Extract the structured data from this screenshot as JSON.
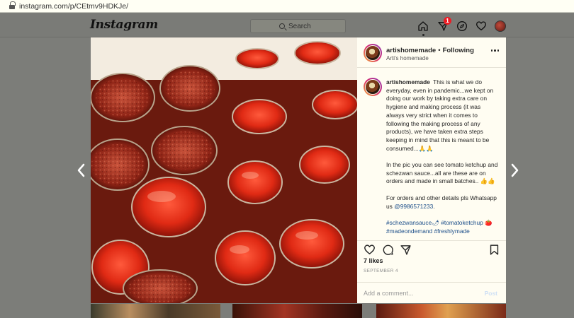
{
  "browser": {
    "url": "instagram.com/p/CEtmv9HDKJe/"
  },
  "header": {
    "logo": "Instagram",
    "search_placeholder": "Search",
    "notification_count": "1"
  },
  "post": {
    "username": "artishomemade",
    "follow_label": "Following",
    "subtitle": "Arti's homemade",
    "caption": {
      "username": "artishomemade",
      "paragraph1": "This is what we do everyday, even in pandemic...we kept on doing our work by taking extra care on hygiene and making process (it was always very strict when it comes to following the making process of any products), we have taken extra steps keeping in mind that this is meant to be consumed...🙏🙏",
      "paragraph2": "In the pic you can see tomato ketchup and schezwan sauce...all are these are on orders and made in small batches.. 👍👍",
      "paragraph3_prefix": "For orders and other details pls Whatsapp us ",
      "phone": "@9986571233",
      "paragraph3_suffix": ".",
      "hashtags": "#schezwansauce🌶 #tomatoketchup 🍅 #madeondemand #freshlymade"
    },
    "likes": "7 likes",
    "date": "September 4",
    "comment_placeholder": "Add a comment...",
    "post_button": "Post"
  },
  "icons": {
    "home": "home-icon",
    "direct": "paper-plane-icon",
    "explore": "compass-icon",
    "activity": "heart-icon",
    "prev": "chevron-left-icon",
    "next": "chevron-right-icon"
  }
}
